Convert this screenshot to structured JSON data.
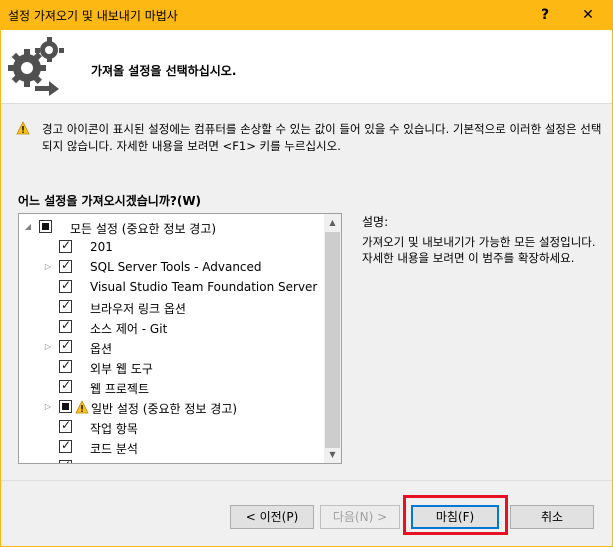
{
  "window": {
    "title": "설정 가져오기 및 내보내기 마법사",
    "help_glyph": "?",
    "close_glyph": "✕",
    "frame_color": "#fdb813"
  },
  "header": {
    "icon": "gears-arrow-icon",
    "heading": "가져올 설정을 선택하십시오."
  },
  "warning": {
    "icon": "warning-icon",
    "text": "경고 아이콘이 표시된 설정에는 컴퓨터를 손상할 수 있는 값이 들어 있을 수 있습니다. 기본적으로 이러한 설정은 선택되지 않습니다. 자세한 내용을 보려면 <F1> 키를 누르십시오."
  },
  "tree": {
    "label": "어느 설정을 가져오시겠습니까?(W)",
    "items": [
      {
        "label": "모든 설정 (중요한 정보 경고)",
        "state": "partial",
        "expander": "expanded",
        "level": 0,
        "warning": false
      },
      {
        "label": "201",
        "state": "checked",
        "expander": "none",
        "level": 1,
        "warning": false
      },
      {
        "label": "SQL Server Tools - Advanced",
        "state": "checked",
        "expander": "collapsed",
        "level": 1,
        "warning": false
      },
      {
        "label": "Visual Studio Team Foundation Server",
        "state": "checked",
        "expander": "none",
        "level": 1,
        "warning": false
      },
      {
        "label": "브라우저 링크 옵션",
        "state": "checked",
        "expander": "none",
        "level": 1,
        "warning": false
      },
      {
        "label": "소스 제어 - Git",
        "state": "checked",
        "expander": "none",
        "level": 1,
        "warning": false
      },
      {
        "label": "옵션",
        "state": "checked",
        "expander": "collapsed",
        "level": 1,
        "warning": false
      },
      {
        "label": "외부 웹 도구",
        "state": "checked",
        "expander": "none",
        "level": 1,
        "warning": false
      },
      {
        "label": "웹 프로젝트",
        "state": "checked",
        "expander": "none",
        "level": 1,
        "warning": false
      },
      {
        "label": "일반 설정 (중요한 정보 경고)",
        "state": "partial",
        "expander": "collapsed",
        "level": 1,
        "warning": true
      },
      {
        "label": "작업 항목",
        "state": "checked",
        "expander": "none",
        "level": 1,
        "warning": false
      },
      {
        "label": "코드 분석",
        "state": "checked",
        "expander": "none",
        "level": 1,
        "warning": false
      },
      {
        "label": "",
        "state": "checked",
        "expander": "none",
        "level": 1,
        "warning": false
      }
    ]
  },
  "description": {
    "title": "설명:",
    "text": "가져오기 및 내보내기가 가능한 모든 설정입니다. 자세한 내용을 보려면 이 범주를 확장하세요."
  },
  "buttons": {
    "back": "< 이전(P)",
    "next": "다음(N) >",
    "finish": "마침(F)",
    "cancel": "취소"
  },
  "colors": {
    "highlight": "#e81123",
    "focus": "#0078d7"
  }
}
